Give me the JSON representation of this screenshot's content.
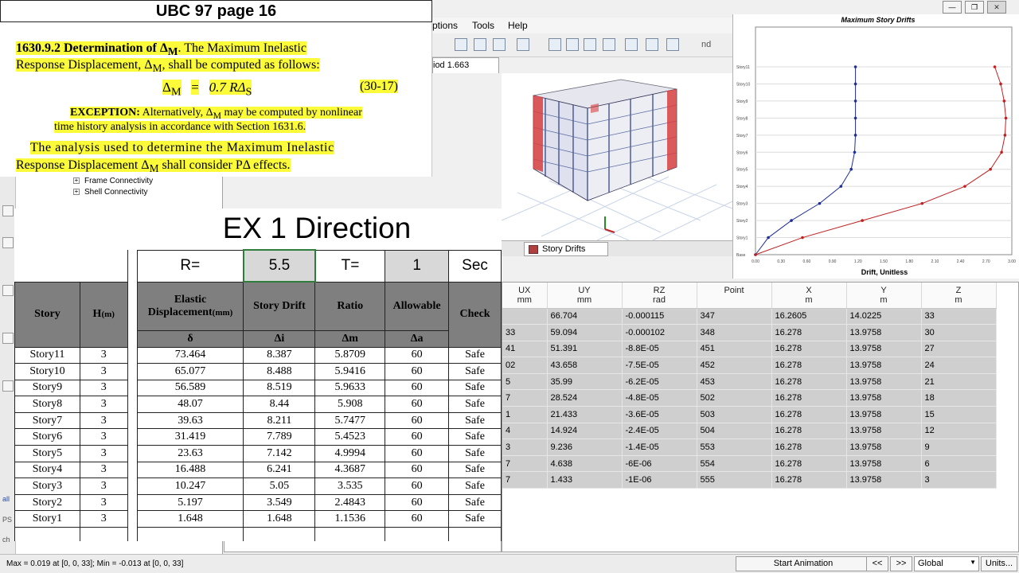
{
  "app": {
    "menu": [
      "ptions",
      "Tools",
      "Help"
    ],
    "period_tab": "iod 1.663",
    "story_tab": "Story Drifts",
    "toolbar_nd": "nd",
    "tree": [
      "Frame Connectivity",
      "Shell Connectivity"
    ],
    "left_fragments": [
      "all",
      "PS",
      "ch"
    ],
    "status_text": "Max = 0.019 at [0, 0, 33];  Min = -0.013 at [0, 0, 33]",
    "start_animation": "Start Animation",
    "prev_btn": "<<",
    "next_btn": ">>",
    "global_value": "Global",
    "units_btn": "Units..."
  },
  "doc": {
    "title": "UBC 97 page 16",
    "sec_num": "1630.9.2 Determination of Δ",
    "sec_sub": "M",
    "line1_rest": ". The Maximum Inelastic",
    "line2a": "Response Displacement, Δ",
    "line2_sub": "M",
    "line2b": ", shall be computed as follows:",
    "formula_lhs": "Δ",
    "formula_lhs_sub": "M",
    "formula_eq": "=",
    "formula_rhs": "0.7 RΔ",
    "formula_rhs_sub": "S",
    "eq_num": "(30-17)",
    "exc_label": "EXCEPTION:",
    "exc_text1": " Alternatively, Δ",
    "exc_sub": "M",
    "exc_text2": " may be computed by nonlinear",
    "exc_line2": "time history analysis in accordance with Section 1631.6.",
    "para_line1": "The analysis used to determine the Maximum Inelastic",
    "para_line2a": "Response Displacement Δ",
    "para_sub": "M",
    "para_line2b": " shall consider PΔ effects."
  },
  "sheet": {
    "title": "EX 1 Direction",
    "r_label": "R=",
    "r_value": "5.5",
    "t_label": "T=",
    "t_value": "1",
    "t_unit": "Sec",
    "headers": {
      "story": "Story",
      "h": "H",
      "h_unit": "(m)",
      "elastic": "Elastic",
      "elastic2": "Displacement",
      "elastic_unit": "(mm)",
      "drift": "Story Drift",
      "ratio": "Ratio",
      "allowable": "Allowable",
      "check": "Check"
    },
    "symbols": {
      "elastic": "δ",
      "drift": "Δi",
      "ratio": "Δm",
      "allowable": "Δa"
    },
    "rows": [
      {
        "story": "Story11",
        "h": "3",
        "disp": "73.464",
        "drift": "8.387",
        "ratio": "5.8709",
        "allow": "60",
        "check": "Safe"
      },
      {
        "story": "Story10",
        "h": "3",
        "disp": "65.077",
        "drift": "8.488",
        "ratio": "5.9416",
        "allow": "60",
        "check": "Safe"
      },
      {
        "story": "Story9",
        "h": "3",
        "disp": "56.589",
        "drift": "8.519",
        "ratio": "5.9633",
        "allow": "60",
        "check": "Safe"
      },
      {
        "story": "Story8",
        "h": "3",
        "disp": "48.07",
        "drift": "8.44",
        "ratio": "5.908",
        "allow": "60",
        "check": "Safe"
      },
      {
        "story": "Story7",
        "h": "3",
        "disp": "39.63",
        "drift": "8.211",
        "ratio": "5.7477",
        "allow": "60",
        "check": "Safe"
      },
      {
        "story": "Story6",
        "h": "3",
        "disp": "31.419",
        "drift": "7.789",
        "ratio": "5.4523",
        "allow": "60",
        "check": "Safe"
      },
      {
        "story": "Story5",
        "h": "3",
        "disp": "23.63",
        "drift": "7.142",
        "ratio": "4.9994",
        "allow": "60",
        "check": "Safe"
      },
      {
        "story": "Story4",
        "h": "3",
        "disp": "16.488",
        "drift": "6.241",
        "ratio": "4.3687",
        "allow": "60",
        "check": "Safe"
      },
      {
        "story": "Story3",
        "h": "3",
        "disp": "10.247",
        "drift": "5.05",
        "ratio": "3.535",
        "allow": "60",
        "check": "Safe"
      },
      {
        "story": "Story2",
        "h": "3",
        "disp": "5.197",
        "drift": "3.549",
        "ratio": "2.4843",
        "allow": "60",
        "check": "Safe"
      },
      {
        "story": "Story1",
        "h": "3",
        "disp": "1.648",
        "drift": "1.648",
        "ratio": "1.1536",
        "allow": "60",
        "check": "Safe"
      }
    ]
  },
  "results": {
    "columns": [
      {
        "name": "UX",
        "unit": "mm"
      },
      {
        "name": "UY",
        "unit": "mm"
      },
      {
        "name": "RZ",
        "unit": "rad"
      },
      {
        "name": "Point",
        "unit": ""
      },
      {
        "name": "X",
        "unit": "m"
      },
      {
        "name": "Y",
        "unit": "m"
      },
      {
        "name": "Z",
        "unit": "m"
      }
    ],
    "rows": [
      [
        "",
        "66.704",
        "-0.000115",
        "347",
        "16.2605",
        "14.0225",
        "33"
      ],
      [
        "33",
        "59.094",
        "-0.000102",
        "348",
        "16.278",
        "13.9758",
        "30"
      ],
      [
        "41",
        "51.391",
        "-8.8E-05",
        "451",
        "16.278",
        "13.9758",
        "27"
      ],
      [
        "02",
        "43.658",
        "-7.5E-05",
        "452",
        "16.278",
        "13.9758",
        "24"
      ],
      [
        "5",
        "35.99",
        "-6.2E-05",
        "453",
        "16.278",
        "13.9758",
        "21"
      ],
      [
        "7",
        "28.524",
        "-4.8E-05",
        "502",
        "16.278",
        "13.9758",
        "18"
      ],
      [
        "1",
        "21.433",
        "-3.6E-05",
        "503",
        "16.278",
        "13.9758",
        "15"
      ],
      [
        "4",
        "14.924",
        "-2.4E-05",
        "504",
        "16.278",
        "13.9758",
        "12"
      ],
      [
        "3",
        "9.236",
        "-1.4E-05",
        "553",
        "16.278",
        "13.9758",
        "9"
      ],
      [
        "7",
        "4.638",
        "-6E-06",
        "554",
        "16.278",
        "13.9758",
        "6"
      ],
      [
        "7",
        "1.433",
        "-1E-06",
        "555",
        "16.278",
        "13.9758",
        "3"
      ]
    ]
  },
  "chart_data": {
    "type": "line",
    "title": "Maximum Story Drifts",
    "xlabel": "Drift, Unitless",
    "ylabel": "",
    "xlim": [
      0,
      3.0
    ],
    "x_ticks": [
      "0.00",
      "0.30",
      "0.60",
      "0.90",
      "1.20",
      "1.50",
      "1.80",
      "2.10",
      "2.40",
      "2.70",
      "3.00"
    ],
    "y_ticks": [
      "Base",
      "Story1",
      "Story2",
      "Story3",
      "Story4",
      "Story5",
      "Story6",
      "Story7",
      "Story8",
      "Story9",
      "Story10",
      "Story11"
    ],
    "series": [
      {
        "color": "#1f2f9a",
        "x": [
          0.0,
          0.15,
          0.42,
          0.75,
          1.0,
          1.12,
          1.16,
          1.17,
          1.17,
          1.17,
          1.17,
          1.17
        ]
      },
      {
        "color": "#c02020",
        "x": [
          0.0,
          0.55,
          1.25,
          1.95,
          2.45,
          2.75,
          2.88,
          2.92,
          2.93,
          2.91,
          2.87,
          2.8
        ]
      }
    ],
    "grid": true
  }
}
